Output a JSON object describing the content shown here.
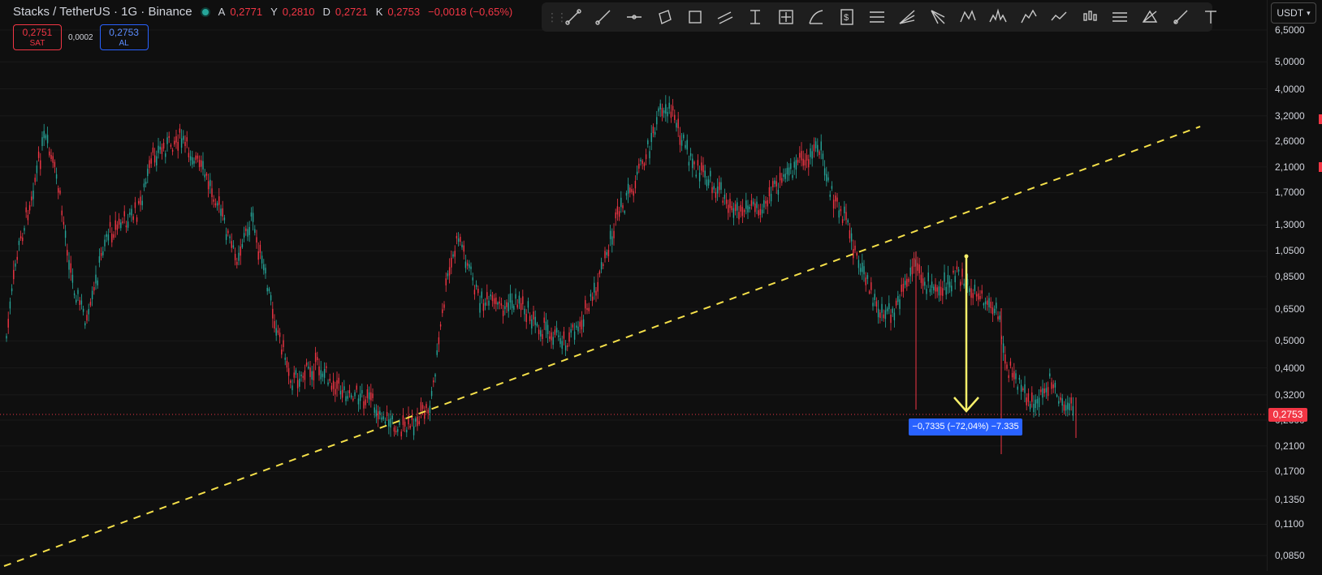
{
  "legend": {
    "symbol": "Stacks / TetherUS · 1G · Binance",
    "open_label": "A",
    "open": "0,2771",
    "high_label": "Y",
    "high": "0,2810",
    "low_label": "D",
    "low": "0,2721",
    "close_label": "K",
    "close": "0,2753",
    "change": "−0,0018 (−0,65%)"
  },
  "bidask": {
    "sell_price": "0,2751",
    "sell_label": "SAT",
    "spread": "0,0002",
    "buy_price": "0,2753",
    "buy_label": "AL"
  },
  "toolbar": {
    "tools": [
      "trend-line-icon",
      "ray-icon",
      "horizontal-line-icon",
      "rotated-rectangle-icon",
      "rectangle-icon",
      "parallel-channel-icon",
      "price-range-icon",
      "date-price-range-icon",
      "arc-icon",
      "long-position-icon",
      "fib-retracement-icon",
      "fib-fan-icon",
      "pitchfork-icon",
      "xabcd-pattern-icon",
      "head-shoulders-icon",
      "elliott-wave-icon",
      "path-icon",
      "candlestick-icon",
      "gann-box-icon",
      "triangle-pattern-icon",
      "brush-icon",
      "text-icon"
    ]
  },
  "price_axis": {
    "currency": "USDT",
    "ticks": [
      "6,5000",
      "5,0000",
      "4,0000",
      "3,2000",
      "2,6000",
      "2,1000",
      "1,7000",
      "1,3000",
      "1,0500",
      "0,8500",
      "0,6500",
      "0,5000",
      "0,4000",
      "0,3200",
      "0,2600",
      "0,2100",
      "0,1700",
      "0,1350",
      "0,1100",
      "0,0850"
    ],
    "last_price": "0,2753"
  },
  "measure": {
    "label": "−0,7335 (−72,04%) −7.335"
  },
  "colors": {
    "up": "#26a69a",
    "down": "#f23645",
    "trendline": "#f5e04a",
    "measure_arrow": "#f7ef6a",
    "measure_label_bg": "#2962ff",
    "background": "#0f0f0f"
  }
}
